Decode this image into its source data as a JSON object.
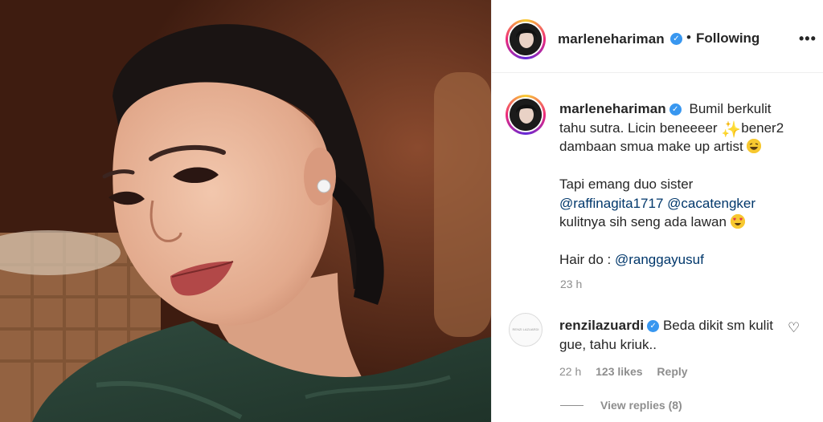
{
  "post": {
    "author": "marlenehariman",
    "follow_status": "Following",
    "separator": "•",
    "more_icon": "•••"
  },
  "caption": {
    "author": "marlenehariman",
    "line1": "Bumil berkulit tahu sutra. Licin beneeeer",
    "line1b": "bener2 dambaan smua make up artist",
    "para2_text": "Tapi emang duo sister",
    "mention1": "@raffinagita1717",
    "mention2": "@cacatengker",
    "para2_end": "kulitnya sih seng ada lawan",
    "para3_prefix": "Hair do :",
    "mention3": "@ranggayusuf",
    "time": "23 h"
  },
  "comment": {
    "author": "renzilazuardi",
    "text": "Beda dikit sm kulit gue, tahu kriuk..",
    "time": "22 h",
    "likes": "123 likes",
    "reply": "Reply",
    "view_replies": "View replies (8)",
    "avatar_text": "RENZI LAZUARDI"
  },
  "icons": {
    "verified": "✓",
    "heart": "♡",
    "sparkle": "✨"
  },
  "colors": {
    "verified_blue": "#3897f0",
    "mention_blue": "#00376b",
    "muted": "#8e8e8e",
    "text": "#262626"
  }
}
